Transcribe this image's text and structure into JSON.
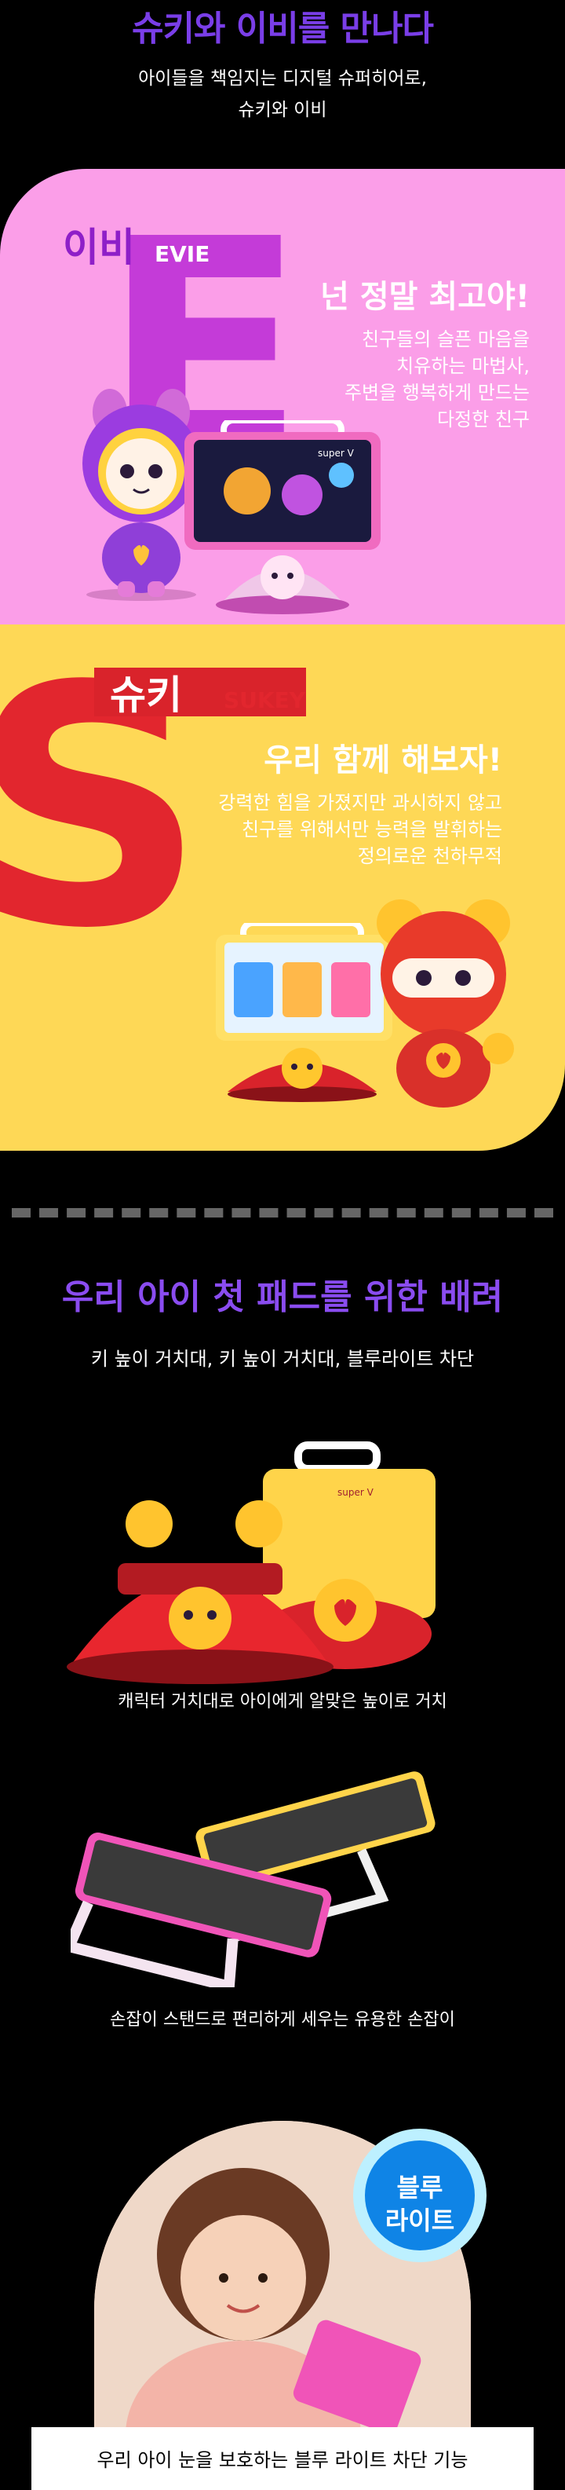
{
  "header": {
    "title": "슈키와 이비를 만나다",
    "subtitle_line1": "아이들을 책임지는 디지털 슈퍼히어로,",
    "subtitle_line2": "슈키와 이비"
  },
  "evie": {
    "letter": "E",
    "name_ko": "이비",
    "name_en": "EVIE",
    "headline": "넌 정말 최고야!",
    "desc_line1": "친구들의 슬픈 마음을",
    "desc_line2": "치유하는 마법사,",
    "desc_line3": "주변을 행복하게 만드는",
    "desc_line4": "다정한 친구",
    "screen_label": "super V"
  },
  "sukey": {
    "letter": "S",
    "name_ko": "슈키",
    "name_en": "SUKEY",
    "headline": "우리 함께 해보자!",
    "desc_line1": "강력한 힘을 가졌지만 과시하지 않고",
    "desc_line2": "친구를 위해서만 능력을 발휘하는",
    "desc_line3": "정의로운 천하무적"
  },
  "features": {
    "title": "우리 아이 첫 패드를 위한 배려",
    "subtitle": "키 높이 거치대, 키 높이 거치대, 블루라이트 차단",
    "caption1": "캐릭터 거치대로 아이에게 알맞은 높이로 거치",
    "caption2": "손잡이 스탠드로 편리하게 세우는 유용한 손잡이",
    "device_brand": "super V"
  },
  "bluelight": {
    "badge_line1": "블루",
    "badge_line2": "라이트",
    "banner": "우리 아이 눈을 보호하는 블루 라이트 차단 기능"
  },
  "colors": {
    "evie_bg": "#fb9ee8",
    "sukey_bg": "#fed856",
    "title_purple": "#7a3ee8",
    "sukey_red": "#e2262e"
  }
}
